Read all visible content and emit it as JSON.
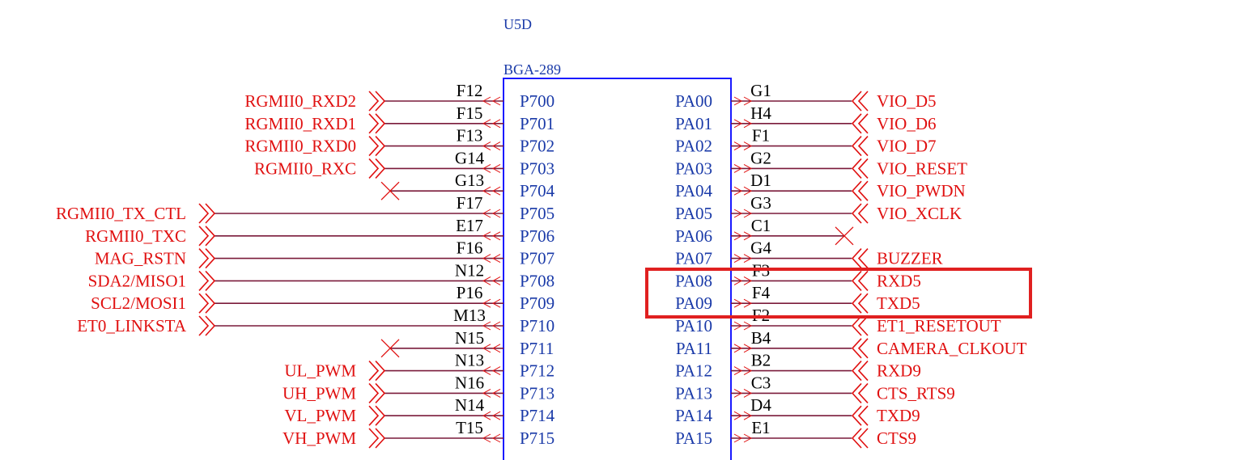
{
  "component": {
    "designator": "U5D",
    "package": "BGA-289"
  },
  "colors": {
    "body_outline": "#1a1aff",
    "pin_name": "#1a3aa8",
    "wire": "#7a1a3a",
    "net_label": "#e01010",
    "no_connect": "#e01010",
    "highlight_box": "#e02020"
  },
  "left_pins": [
    {
      "number": "F12",
      "name": "P700",
      "net": "RGMII0_RXD2",
      "label_type": "input"
    },
    {
      "number": "F15",
      "name": "P701",
      "net": "RGMII0_RXD1",
      "label_type": "input"
    },
    {
      "number": "F13",
      "name": "P702",
      "net": "RGMII0_RXD0",
      "label_type": "input"
    },
    {
      "number": "G14",
      "name": "P703",
      "net": "RGMII0_RXC",
      "label_type": "input"
    },
    {
      "number": "G13",
      "name": "P704",
      "net": "",
      "label_type": "no_connect"
    },
    {
      "number": "F17",
      "name": "P705",
      "net": "RGMII0_TX_CTL",
      "label_type": "output"
    },
    {
      "number": "E17",
      "name": "P706",
      "net": "RGMII0_TXC",
      "label_type": "output"
    },
    {
      "number": "F16",
      "name": "P707",
      "net": "MAG_RSTN",
      "label_type": "output"
    },
    {
      "number": "N12",
      "name": "P708",
      "net": "SDA2/MISO1",
      "label_type": "output"
    },
    {
      "number": "P16",
      "name": "P709",
      "net": "SCL2/MOSI1",
      "label_type": "output"
    },
    {
      "number": "M13",
      "name": "P710",
      "net": "ET0_LINKSTA",
      "label_type": "output"
    },
    {
      "number": "N15",
      "name": "P711",
      "net": "",
      "label_type": "no_connect"
    },
    {
      "number": "N13",
      "name": "P712",
      "net": "UL_PWM",
      "label_type": "input"
    },
    {
      "number": "N16",
      "name": "P713",
      "net": "UH_PWM",
      "label_type": "input"
    },
    {
      "number": "N14",
      "name": "P714",
      "net": "VL_PWM",
      "label_type": "input"
    },
    {
      "number": "T15",
      "name": "P715",
      "net": "VH_PWM",
      "label_type": "input"
    }
  ],
  "right_pins": [
    {
      "number": "G1",
      "name": "PA00",
      "net": "VIO_D5",
      "label_type": "input",
      "highlighted": false
    },
    {
      "number": "H4",
      "name": "PA01",
      "net": "VIO_D6",
      "label_type": "input",
      "highlighted": false
    },
    {
      "number": "F1",
      "name": "PA02",
      "net": "VIO_D7",
      "label_type": "input",
      "highlighted": false
    },
    {
      "number": "G2",
      "name": "PA03",
      "net": "VIO_RESET",
      "label_type": "input",
      "highlighted": false
    },
    {
      "number": "D1",
      "name": "PA04",
      "net": "VIO_PWDN",
      "label_type": "input",
      "highlighted": false
    },
    {
      "number": "G3",
      "name": "PA05",
      "net": "VIO_XCLK",
      "label_type": "input",
      "highlighted": false
    },
    {
      "number": "C1",
      "name": "PA06",
      "net": "",
      "label_type": "no_connect",
      "highlighted": false
    },
    {
      "number": "G4",
      "name": "PA07",
      "net": "BUZZER",
      "label_type": "input",
      "highlighted": false
    },
    {
      "number": "F3",
      "name": "PA08",
      "net": "RXD5",
      "label_type": "input",
      "highlighted": true
    },
    {
      "number": "F4",
      "name": "PA09",
      "net": "TXD5",
      "label_type": "input",
      "highlighted": true
    },
    {
      "number": "F2",
      "name": "PA10",
      "net": "ET1_RESETOUT",
      "label_type": "input",
      "highlighted": false
    },
    {
      "number": "B4",
      "name": "PA11",
      "net": "CAMERA_CLKOUT",
      "label_type": "input",
      "highlighted": false
    },
    {
      "number": "B2",
      "name": "PA12",
      "net": "RXD9",
      "label_type": "input",
      "highlighted": false
    },
    {
      "number": "C3",
      "name": "PA13",
      "net": "CTS_RTS9",
      "label_type": "input",
      "highlighted": false
    },
    {
      "number": "D4",
      "name": "PA14",
      "net": "TXD9",
      "label_type": "input",
      "highlighted": false
    },
    {
      "number": "E1",
      "name": "PA15",
      "net": "CTS9",
      "label_type": "input",
      "highlighted": false
    }
  ]
}
